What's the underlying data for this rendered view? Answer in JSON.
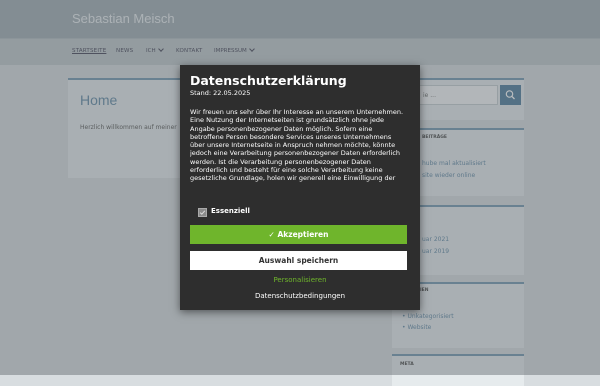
{
  "site": {
    "title": "Sebastian Meisch"
  },
  "nav": {
    "items": [
      {
        "label": "STARTSEITE"
      },
      {
        "label": "NEWS"
      },
      {
        "label": "ICH"
      },
      {
        "label": "KONTAKT"
      },
      {
        "label": "IMPRESSUM"
      }
    ]
  },
  "main": {
    "heading": "Home",
    "welcome": "Herzlich willkommen auf meiner"
  },
  "sidebar": {
    "search_placeholder": "ie ...",
    "recent_heading": "BEITRÄGE",
    "recent_items": [
      "hube mal aktualisiert",
      "site wieder online"
    ],
    "archive_items": [
      "uar 2021",
      "uar 2019"
    ],
    "categories_heading": "IEN",
    "category_items": [
      "Unkategorisiert",
      "Website"
    ],
    "meta_heading": "META"
  },
  "dialog": {
    "title": "Datenschutzerklärung",
    "date": "Stand: 22.05.2025",
    "body": "Wir freuen uns sehr über Ihr Interesse an unserem Unternehmen. Eine Nutzung der Internetseiten ist grundsätzlich ohne jede Angabe personenbezogener Daten möglich. Sofern eine betroffene Person besondere Services unseres Unternehmens über unsere Internetseite in Anspruch nehmen möchte, könnte jedoch eine Verarbeitung personenbezogener Daten erforderlich werden. Ist die Verarbeitung personenbezogener Daten erforderlich und besteht für eine solche Verarbeitung keine gesetzliche Grundlage, holen wir generell eine Einwilligung der",
    "checkbox_label": "Essenziell",
    "accept_label": "✓ Akzeptieren",
    "save_label": "Auswahl speichern",
    "personalize_label": "Personalisieren",
    "privacy_label": "Datenschutzbedingungen",
    "accent_color": "#6fb52c"
  }
}
